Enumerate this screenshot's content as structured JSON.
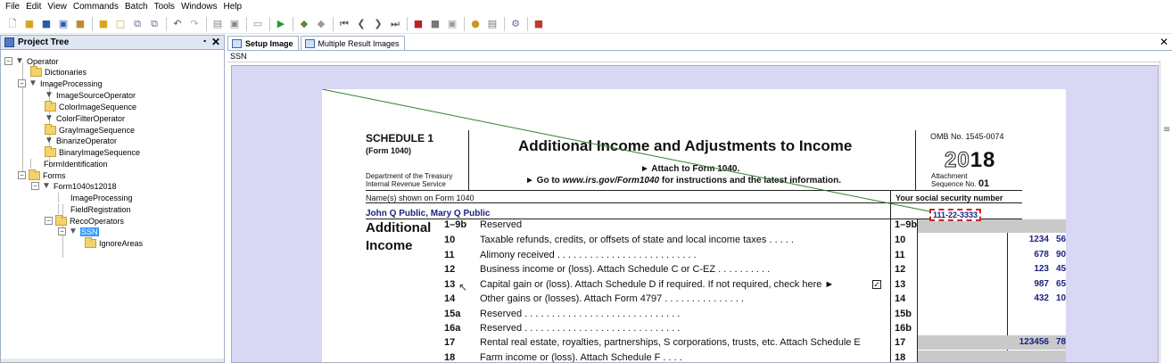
{
  "menu": [
    "File",
    "Edit",
    "View",
    "Commands",
    "Batch",
    "Tools",
    "Windows",
    "Help"
  ],
  "project_tree": {
    "title": "Project Tree",
    "nodes": [
      {
        "label": "Operator"
      },
      {
        "label": "Dictionaries"
      },
      {
        "label": "ImageProcessing"
      },
      {
        "label": "ImageSourceOperator"
      },
      {
        "label": "ColorImageSequence"
      },
      {
        "label": "ColorFilterOperator"
      },
      {
        "label": "GrayImageSequence"
      },
      {
        "label": "BinarizeOperator"
      },
      {
        "label": "BinaryImageSequence"
      },
      {
        "label": "FormIdentification"
      },
      {
        "label": "Forms"
      },
      {
        "label": "Form1040s12018"
      },
      {
        "label": "ImageProcessing"
      },
      {
        "label": "FieldRegistration"
      },
      {
        "label": "RecoOperators"
      },
      {
        "label": "SSN"
      },
      {
        "label": "IgnoreAreas"
      }
    ]
  },
  "tabs": [
    {
      "label": "Setup Image"
    },
    {
      "label": "Multiple Result Images"
    }
  ],
  "field_name": "SSN",
  "document": {
    "schedule": "SCHEDULE 1",
    "form": "(Form 1040)",
    "dept_line1": "Department of the Treasury",
    "dept_line2": "Internal Revenue Service",
    "title": "Additional Income and Adjustments to Income",
    "attach": "► Attach to Form 1040.",
    "goto_pre": "► Go to ",
    "goto_url": "www.irs.gov/Form1040",
    "goto_post": " for instructions and the latest information.",
    "omb": "OMB No. 1545-0074",
    "year_outline": "20",
    "year_bold": "18",
    "attachment_line1": "Attachment",
    "attachment_line2": "Sequence No.",
    "sequence_no": "01",
    "names_header": "Name(s) shown on Form 1040",
    "ssn_header": "Your social security number",
    "names_value": "John Q Public, Mary Q Public",
    "ssn_value": "111-22-3333",
    "section_line1": "Additional",
    "section_line2": "Income",
    "checkbox_mark": "✓",
    "lines": [
      {
        "ln": "1–9b",
        "desc": "Reserved",
        "bln": "1–9b",
        "amt": "",
        "cents": ""
      },
      {
        "ln": "10",
        "desc": "Taxable refunds, credits, or offsets of state and local income taxes  .  .  .  .  .",
        "bln": "10",
        "amt": "1234",
        "cents": "56"
      },
      {
        "ln": "11",
        "desc": "Alimony received  .  .  .  .  .  .  .  .  .  .  .  .  .  .  .  .  .  .  .  .  .  .  .  .  .  .",
        "bln": "11",
        "amt": "678",
        "cents": "90"
      },
      {
        "ln": "12",
        "desc": "Business income or (loss). Attach Schedule C or C-EZ  .  .  .  .  .  .  .  .  .  .",
        "bln": "12",
        "amt": "123",
        "cents": "45"
      },
      {
        "ln": "13",
        "desc": "Capital gain or (loss). Attach Schedule D if required. If not required, check here  ►",
        "bln": "13",
        "amt": "987",
        "cents": "65"
      },
      {
        "ln": "14",
        "desc": "Other gains or (losses). Attach Form 4797  .  .  .  .  .  .  .  .  .  .  .  .  .  .  .",
        "bln": "14",
        "amt": "432",
        "cents": "10"
      },
      {
        "ln": "15a",
        "desc": "Reserved  .  .  .  .  .  .  .  .  .  .  .  .  .  .  .  .  .  .  .  .  .  .  .  .  .  .  .  .  .",
        "bln": "15b",
        "amt": "",
        "cents": ""
      },
      {
        "ln": "16a",
        "desc": "Reserved  .  .  .  .  .  .  .  .  .  .  .  .  .  .  .  .  .  .  .  .  .  .  .  .  .  .  .  .  .",
        "bln": "16b",
        "amt": "",
        "cents": ""
      },
      {
        "ln": "17",
        "desc": "Rental real estate, royalties, partnerships, S corporations, trusts, etc. Attach Schedule E",
        "bln": "17",
        "amt": "123456",
        "cents": "78"
      },
      {
        "ln": "18",
        "desc": "Farm income or (loss). Attach Schedule F  .  .  .  .",
        "bln": "18",
        "amt": "",
        "cents": ""
      }
    ]
  },
  "colors": {
    "accent": "#3399ff",
    "filled_value": "#1a237e",
    "selection_border": "#c62828",
    "registration_line": "#2e7d32",
    "viewer_bg": "#d8d8f4"
  }
}
